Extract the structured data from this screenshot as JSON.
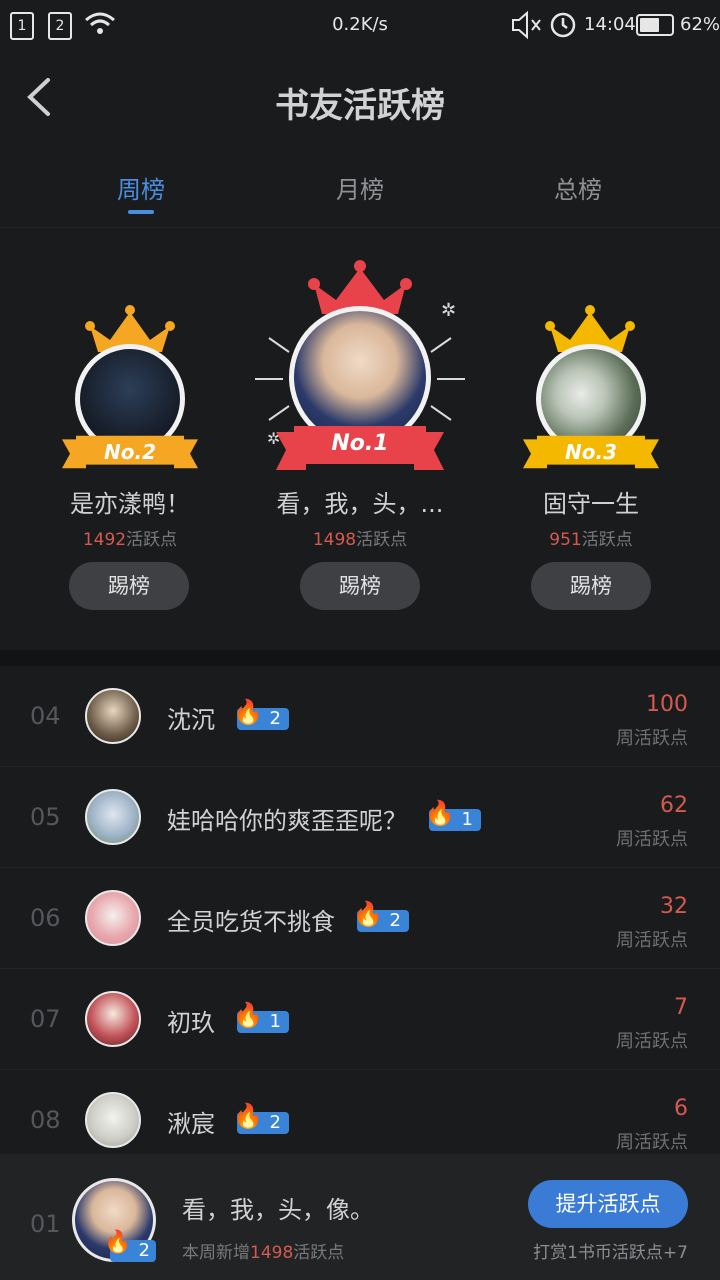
{
  "status_bar": {
    "sim1": "1",
    "sim2": "2",
    "net_speed": "0.2K/s",
    "time": "14:04",
    "battery": "62%",
    "battery_level": 0.62
  },
  "header": {
    "title": "书友活跃榜"
  },
  "tabs": [
    {
      "label": "周榜",
      "active": true
    },
    {
      "label": "月榜",
      "active": false
    },
    {
      "label": "总榜",
      "active": false
    }
  ],
  "podium": [
    {
      "rank_label": "No.2",
      "name": "是亦漾鸭！",
      "points": "1492",
      "points_suffix": "活跃点",
      "button": "踢榜",
      "accent": "#f5a623"
    },
    {
      "rank_label": "No.1",
      "name": "看，我，头，...",
      "points": "1498",
      "points_suffix": "活跃点",
      "button": "踢榜",
      "accent": "#e8434a"
    },
    {
      "rank_label": "No.3",
      "name": "固守一生",
      "points": "951",
      "points_suffix": "活跃点",
      "button": "踢榜",
      "accent": "#f5b800"
    }
  ],
  "list": [
    {
      "rank": "04",
      "name": "沈沉",
      "level": "2",
      "points": "100",
      "unit": "周活跃点"
    },
    {
      "rank": "05",
      "name": "娃哈哈你的爽歪歪呢？",
      "level": "1",
      "points": "62",
      "unit": "周活跃点"
    },
    {
      "rank": "06",
      "name": "全员吃货不挑食",
      "level": "2",
      "points": "32",
      "unit": "周活跃点"
    },
    {
      "rank": "07",
      "name": "初玖",
      "level": "1",
      "points": "7",
      "unit": "周活跃点"
    },
    {
      "rank": "08",
      "name": "湫宸",
      "level": "2",
      "points": "6",
      "unit": "周活跃点"
    }
  ],
  "my_rank": {
    "rank": "01",
    "name": "看，我，头，像。",
    "level": "2",
    "sub_prefix": "本周新增",
    "sub_points": "1498",
    "sub_suffix": "活跃点",
    "button": "提升活跃点",
    "hint": "打赏1书币活跃点+7"
  },
  "colors": {
    "accent_blue": "#4a8ee0",
    "points_red": "#d45a4f",
    "background": "#1a1b1d"
  },
  "icons": [
    "back-arrow-icon",
    "wifi-icon",
    "mute-icon",
    "alarm-icon",
    "battery-icon",
    "crown-icon",
    "flame-icon"
  ]
}
